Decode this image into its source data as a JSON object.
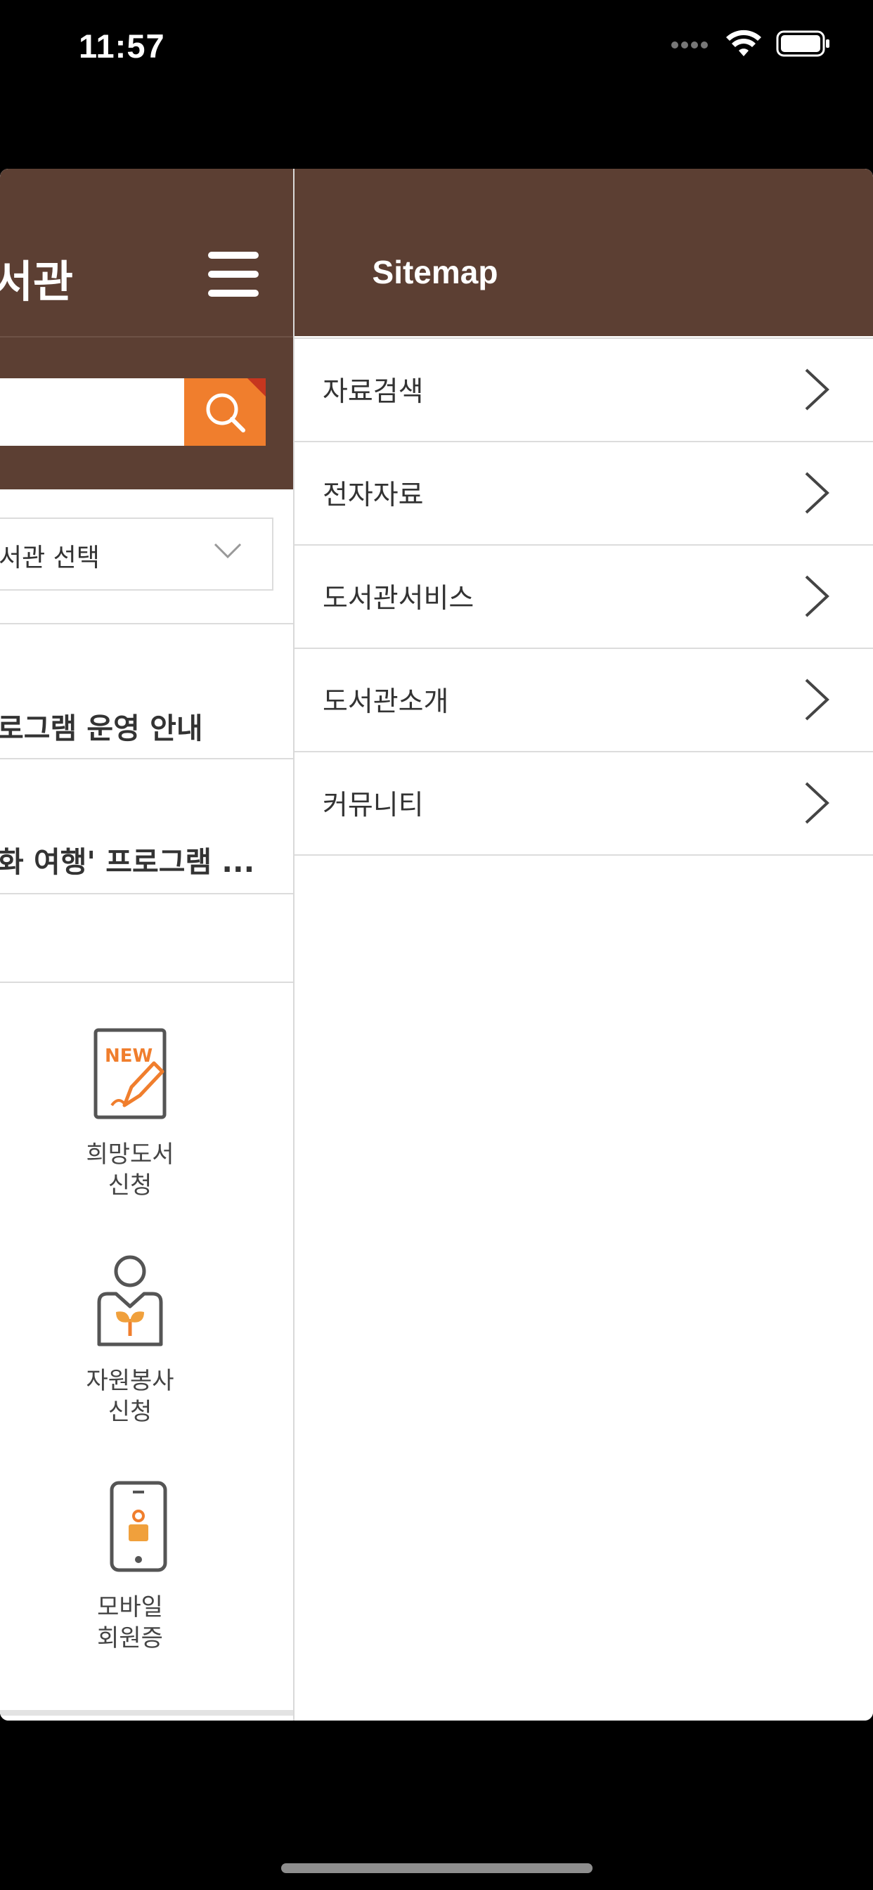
{
  "status_bar": {
    "time": "11:57",
    "icons": [
      "signal-dots-icon",
      "wifi-icon",
      "battery-icon"
    ]
  },
  "left_panel": {
    "title": "서관",
    "search": {
      "placeholder": ""
    },
    "library_select": {
      "label": "서관 선택"
    },
    "news": [
      "로그램 운영 안내",
      "화 여행' 프로그램 ..."
    ],
    "quick_links": [
      {
        "icon": "new-request-icon",
        "badge": "NEW",
        "line1": "희망도서",
        "line2": "신청"
      },
      {
        "icon": "volunteer-icon",
        "line1": "자원봉사",
        "line2": "신청"
      },
      {
        "icon": "mobile-card-icon",
        "line1": "모바일",
        "line2": "회원증"
      }
    ]
  },
  "sitemap": {
    "title": "Sitemap",
    "items": [
      {
        "label": "자료검색"
      },
      {
        "label": "전자자료"
      },
      {
        "label": "도서관서비스"
      },
      {
        "label": "도서관소개"
      },
      {
        "label": "커뮤니티"
      }
    ]
  },
  "colors": {
    "header_brown": "#5c3f33",
    "accent_orange": "#f07e2d",
    "divider": "#dcdcdc"
  }
}
